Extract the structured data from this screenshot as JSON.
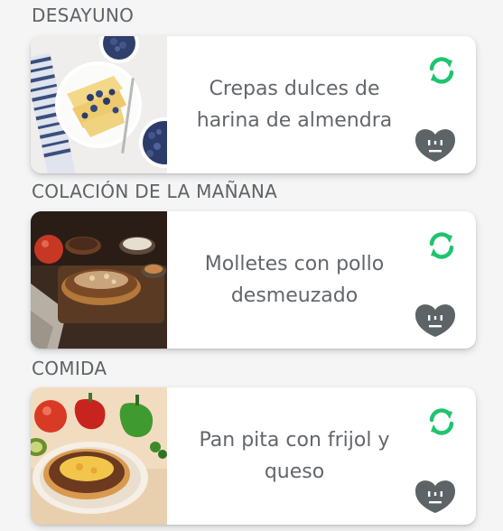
{
  "sections": [
    {
      "title": "DESAYUNO",
      "meal_name": "Crepas dulces de harina de almendra",
      "image_icon": "crepes-blueberries-photo"
    },
    {
      "title": "COLACIÓN DE LA MAÑANA",
      "meal_name": "Molletes con pollo desmeuzado",
      "image_icon": "molletes-chicken-photo"
    },
    {
      "title": "COMIDA",
      "meal_name": "Pan pita con frijol y queso",
      "image_icon": "pita-bean-cheese-photo"
    }
  ],
  "icons": {
    "swap": "refresh-icon",
    "mood": "neutral-face-heart-icon"
  },
  "colors": {
    "swap_accent": "#1fc46e",
    "mood_icon": "#5c6467",
    "text": "#63666b",
    "heading": "#5f6266"
  }
}
